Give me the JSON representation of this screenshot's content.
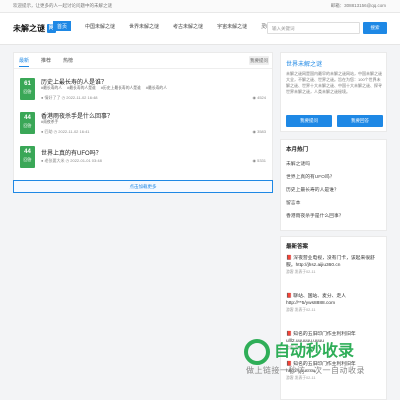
{
  "topbar": {
    "notice": "欢迎提示，让更多的人一起讨论问题中的未解之谜",
    "contact": "邮箱：308813156@qq.com"
  },
  "logo": {
    "text": "未解之谜",
    "mark": "网"
  },
  "nav": [
    "首页",
    "中国未解之谜",
    "世界未解之谜",
    "考古未解之谜",
    "宇宙未解之谜",
    "灵魂未解之谜"
  ],
  "search": {
    "placeholder": "输入关键词",
    "button": "搜索"
  },
  "tabs": [
    "最新",
    "推荐",
    "热榜"
  ],
  "ask_button": "我要提问",
  "questions": [
    {
      "count": "61",
      "count_label": "回答",
      "title": "历史上最长寿的人是谁？",
      "tags": [
        "#最长寿的人",
        "#最长寿的人是谁",
        "#历史上最长寿的人是谁",
        "#最长寿的人"
      ],
      "meta": "● 情好了了  ◷ 2022-11-02 16:48",
      "views": "◉ 4524"
    },
    {
      "count": "44",
      "count_label": "回答",
      "title": "香港雨夜杀手是什么回事？",
      "tags": [
        "#雨夜杀手"
      ],
      "meta": "● 匹助  ◷ 2022-11-02 16:41",
      "views": "◉ 3583"
    },
    {
      "count": "44",
      "count_label": "回答",
      "title": "世界上真的有UFO吗？",
      "tags": [],
      "meta": "● 老张要大米  ◷ 2022-01-01 03:48",
      "views": "◉ 5331"
    }
  ],
  "load_more": "点击加载更多",
  "about": {
    "head": "世界未解之谜",
    "desc": "未解之谜网是国内最早的未解之谜网站，中国未解之谜大全，不解之谜、世界之谜。旨在为您：100个世界未解之谜、世界十大未解之谜、中国十大未解之谜、探寻世界未解之谜，人类未解之谜秘境。",
    "ask": "我要提问",
    "answer": "我要回答"
  },
  "hot": {
    "head": "本月热门",
    "items": [
      "未解之谜吗",
      "世界上真的有UFO吗？",
      "历史上最长寿的人是谁？",
      "留言本",
      "香港雨夜杀手是什么回事？"
    ]
  },
  "answers": {
    "head": "最新答案",
    "items": [
      {
        "text": "📕 深夜营业电视，没有门卡，该起来很舒服。http://jhsz.aijiu360.cn",
        "sub": "游客  发表于02-11"
      },
      {
        "text": "📕 聊站、国站、麦分、走人 http://**5/yws8888.com",
        "sub": "游客  发表于02-11"
      },
      {
        "text": "📕 知名的五旧印门作主利利旧年ulll2.uuuuuu.uuuu",
        "sub": "游客  发表于02-11"
      },
      {
        "text": "📕 知名的五旧印门作主利利旧年 http://uuuu.uu",
        "sub": "游客  发表于02-11"
      }
    ]
  },
  "watermark": {
    "big": "自动秒收录",
    "small": "做上链接一秒访一次一自动收录"
  }
}
